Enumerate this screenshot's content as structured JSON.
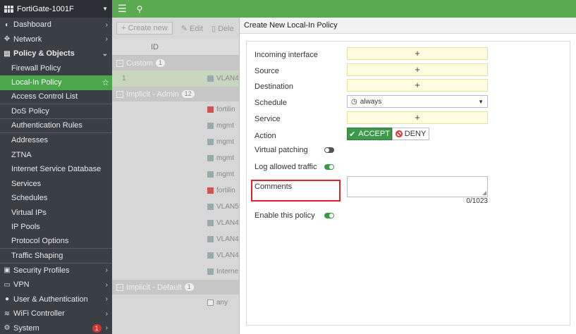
{
  "device": {
    "name": "FortiGate-1001F"
  },
  "sidebar": {
    "items": [
      {
        "label": "Dashboard",
        "icon": "dashboard-icon",
        "glyph": "◐"
      },
      {
        "label": "Network",
        "icon": "network-icon",
        "glyph": "✥"
      },
      {
        "label": "Policy & Objects",
        "icon": "policy-icon",
        "glyph": "▤",
        "expanded": true
      }
    ],
    "sub_items": [
      "Firewall Policy",
      "Local-In Policy",
      "Access Control List",
      "DoS Policy",
      "Authentication Rules",
      "Addresses",
      "ZTNA",
      "Internet Service Database",
      "Services",
      "Schedules",
      "Virtual IPs",
      "IP Pools",
      "Protocol Options",
      "Traffic Shaping"
    ],
    "bottom_items": [
      {
        "label": "Security Profiles",
        "icon": "lock-icon",
        "glyph": "🔒"
      },
      {
        "label": "VPN",
        "icon": "vpn-icon",
        "glyph": "▭"
      },
      {
        "label": "User & Authentication",
        "icon": "user-icon",
        "glyph": "👤"
      },
      {
        "label": "WiFi Controller",
        "icon": "wifi-icon",
        "glyph": "≋"
      },
      {
        "label": "System",
        "icon": "gear-icon",
        "glyph": "⚙",
        "badge": "1"
      }
    ]
  },
  "background_list": {
    "toolbar": {
      "create": "Create new",
      "edit": "Edit",
      "delete": "Dele"
    },
    "column_id": "ID",
    "groups": {
      "custom": {
        "label": "Custom",
        "count": "1"
      },
      "implicit_admin": {
        "label": "Implicit - Admin",
        "count": "12"
      },
      "implicit_default": {
        "label": "Implicit - Default",
        "count": "1"
      }
    },
    "custom_rows": [
      {
        "id": "1",
        "entry": "VLAN4"
      }
    ],
    "admin_rows": [
      "fortilin",
      "mgmt",
      "mgmt",
      "mgmt",
      "mgmt",
      "fortilin",
      "VLAN5",
      "VLAN4",
      "VLAN4",
      "VLAN4",
      "Interne"
    ],
    "default_rows": [
      "any"
    ]
  },
  "dialog": {
    "title": "Create New Local-In Policy",
    "fields": {
      "incoming_interface": "Incoming interface",
      "source": "Source",
      "destination": "Destination",
      "schedule": "Schedule",
      "schedule_value": "always",
      "service": "Service",
      "action": "Action",
      "accept": "ACCEPT",
      "deny": "DENY",
      "virtual_patching": "Virtual patching",
      "log_allowed_traffic": "Log allowed traffic",
      "comments": "Comments",
      "comments_counter": "0/1023",
      "enable_policy": "Enable this policy"
    },
    "plus": "+",
    "toggles": {
      "virtual_patching": "off",
      "log_allowed_traffic": "on",
      "enable_policy": "on"
    },
    "action_selected": "ACCEPT",
    "highlight_color": "#e0202a"
  }
}
